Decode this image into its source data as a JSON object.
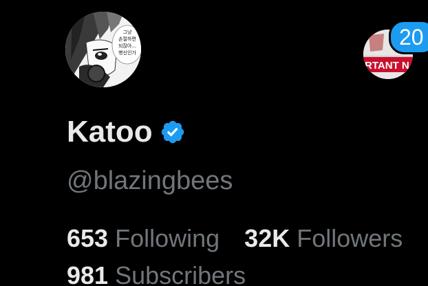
{
  "profile": {
    "display_name": "Katoo",
    "handle": "@blazingbees",
    "verified": true,
    "avatar_bubble_text": [
      "그냥",
      "손절하면",
      "되잖아...",
      "병신인가"
    ]
  },
  "account_switcher": {
    "badge_count": "20",
    "banner_text": "RTANT N"
  },
  "stats": {
    "following": {
      "count": "653",
      "label": "Following"
    },
    "followers": {
      "count": "32K",
      "label": "Followers"
    },
    "subscribers": {
      "count": "981",
      "label": "Subscribers"
    }
  },
  "colors": {
    "background": "#000000",
    "primary_text": "#e7e9ea",
    "secondary_text": "#71767b",
    "accent": "#1d9bf0"
  }
}
